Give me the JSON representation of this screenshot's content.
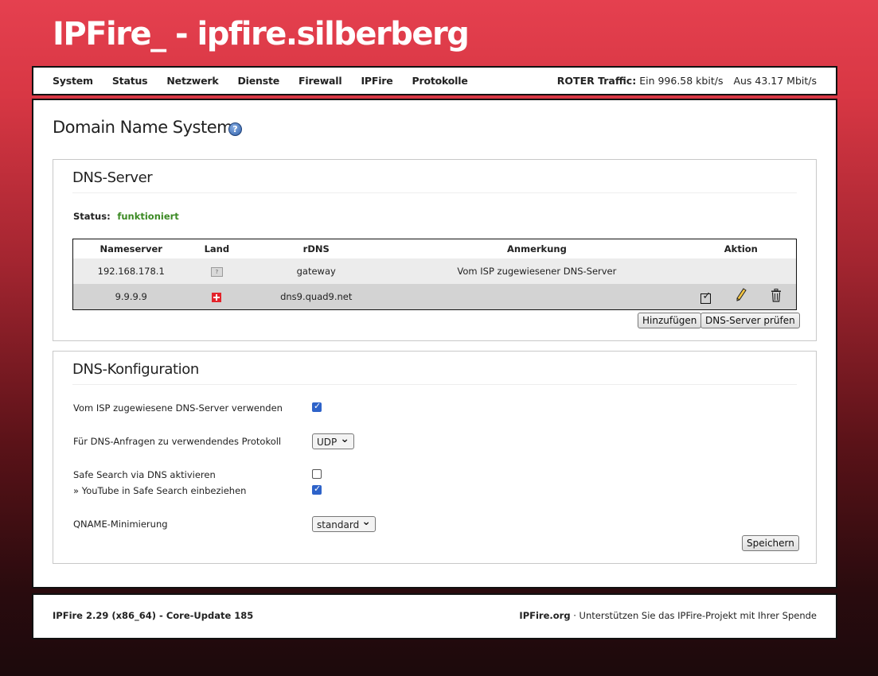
{
  "brand": "IPFire_ - ipfire.silberberg",
  "nav": {
    "items": [
      "System",
      "Status",
      "Netzwerk",
      "Dienste",
      "Firewall",
      "IPFire",
      "Protokolle"
    ],
    "traffic_label": "ROTER Traffic:",
    "traffic_in": "Ein 996.58 kbit/s",
    "traffic_out": "Aus 43.17 Mbit/s"
  },
  "page": {
    "title": "Domain Name System",
    "help_icon": "help-icon"
  },
  "dns_server": {
    "heading": "DNS-Server",
    "status_label": "Status:",
    "status_value": "funktioniert",
    "status_color": "#3c8a24",
    "columns": [
      "Nameserver",
      "Land",
      "rDNS",
      "Anmerkung",
      "Aktion"
    ],
    "rows": [
      {
        "nameserver": "192.168.178.1",
        "land": "unknown-flag-icon",
        "rdns": "gateway",
        "anmerkung": "Vom ISP zugewiesener DNS-Server"
      },
      {
        "nameserver": "9.9.9.9",
        "land": "swiss-flag-icon",
        "rdns": "dns9.quad9.net",
        "anmerkung": "",
        "actions": [
          "checkbox-icon",
          "pencil-icon",
          "trash-icon"
        ]
      }
    ],
    "btn_add": "Hinzufügen",
    "btn_check": "DNS-Server prüfen"
  },
  "dns_config": {
    "heading": "DNS-Konfiguration",
    "isp_label": "Vom ISP zugewiesene DNS-Server verwenden",
    "isp_checked": true,
    "protocol_label": "Für DNS-Anfragen zu verwendendes Protokoll",
    "protocol_value": "UDP",
    "safesearch_label": "Safe Search via DNS aktivieren",
    "safesearch_checked": false,
    "youtube_label": "» YouTube in Safe Search einbeziehen",
    "youtube_checked": true,
    "qname_label": "QNAME-Minimierung",
    "qname_value": "standard",
    "save": "Speichern"
  },
  "footer": {
    "version": "IPFire 2.29 (x86_64) - Core-Update 185",
    "site": "IPFire.org",
    "donate": " · Unterstützen Sie das IPFire-Projekt mit Ihrer Spende"
  }
}
